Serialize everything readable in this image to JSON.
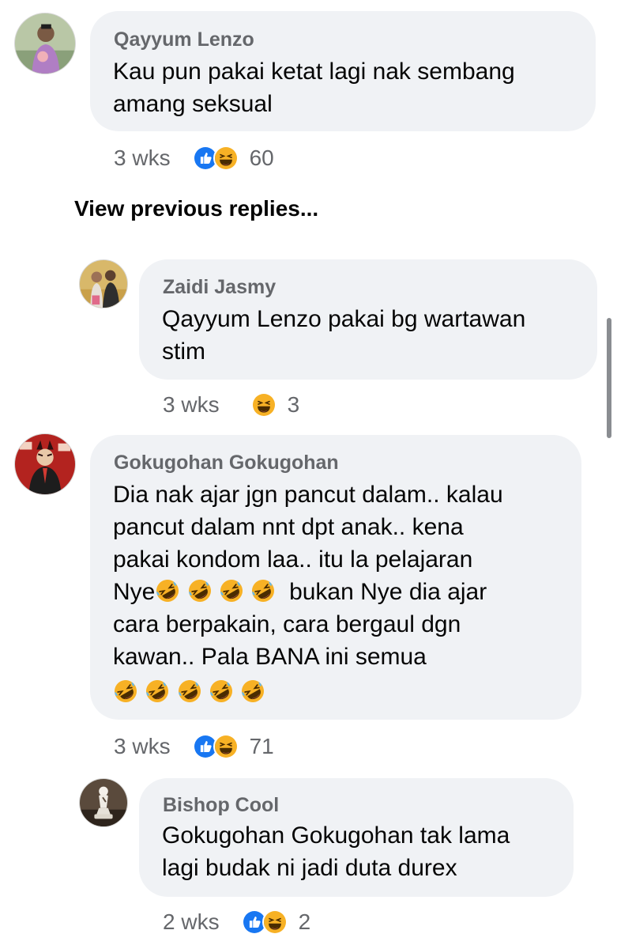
{
  "comments": [
    {
      "author": "Qayyum Lenzo",
      "text": "Kau pun pakai ketat lagi nak sembang\namang seksual",
      "time": "3 wks",
      "reactions": [
        "like",
        "haha"
      ],
      "reaction_count": "60"
    },
    {
      "author": "Zaidi Jasmy",
      "text": "Qayyum Lenzo pakai bg wartawan\nstim",
      "time": "3 wks",
      "reactions": [
        "haha"
      ],
      "reaction_count": "3"
    },
    {
      "author": "Gokugohan Gokugohan",
      "text_lines": [
        "Dia nak ajar jgn pancut dalam.. kalau",
        "pancut dalam nnt dpt anak.. kena",
        "pakai kondom laa.. itu la pelajaran",
        "Nye",
        "bukan Nye dia ajar",
        "cara berpakain, cara bergaul dgn",
        "kawan.. Pala BANA ini semua"
      ],
      "time": "3 wks",
      "reactions": [
        "like",
        "haha"
      ],
      "reaction_count": "71"
    },
    {
      "author": "Bishop Cool",
      "text": "Gokugohan Gokugohan tak lama\nlagi budak ni jadi duta durex",
      "time": "2 wks",
      "reactions": [
        "like",
        "haha"
      ],
      "reaction_count": "2"
    }
  ],
  "view_previous_replies": "View previous replies...",
  "icons": {
    "like": "like-reaction-icon",
    "haha": "haha-reaction-icon",
    "rofl": "rolling-on-floor-laughing-emoji"
  },
  "colors": {
    "bubble": "#f0f2f5",
    "author": "#65676b",
    "like_blue": "#1877f2",
    "haha_yellow": "#f7b125"
  }
}
